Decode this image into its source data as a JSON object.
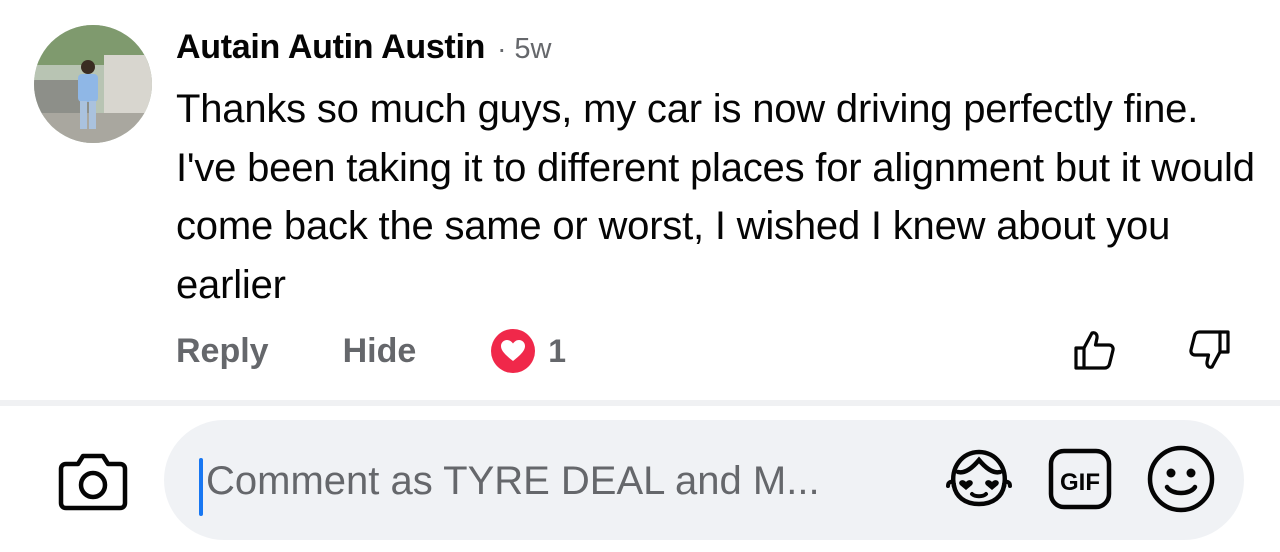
{
  "comment": {
    "author": "Autain Autin Austin",
    "separator": "·",
    "time": "5w",
    "text": "Thanks so much guys, my car is now driving perfectly fine. I've been taking it to different places for alignment but it would come back the same or worst, I wished I knew about you earlier",
    "actions": {
      "reply_label": "Reply",
      "hide_label": "Hide"
    },
    "reaction": {
      "icon": "heart-icon",
      "count": "1"
    }
  },
  "composer": {
    "placeholder": "Comment as TYRE DEAL and M...",
    "value": "",
    "gif_label": "GIF"
  },
  "colors": {
    "accent": "#1877f2",
    "reaction_red": "#f0284a",
    "secondary_text": "#65676b",
    "input_bg": "#f0f2f5"
  }
}
